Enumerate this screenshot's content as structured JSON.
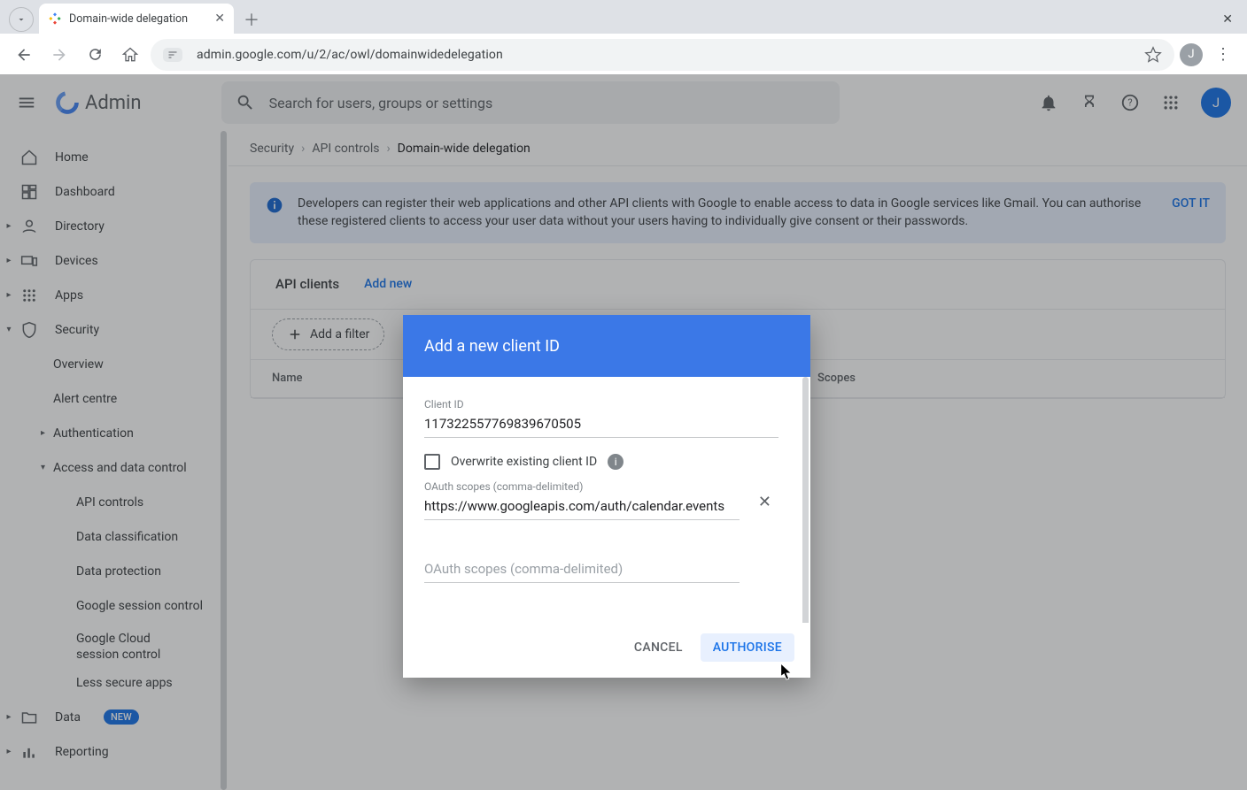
{
  "browser": {
    "tab_title": "Domain-wide delegation",
    "url": "admin.google.com/u/2/ac/owl/domainwidedelegation",
    "avatar_initial": "J"
  },
  "admin": {
    "brand": "Admin",
    "search_placeholder": "Search for users, groups or settings",
    "avatar_initial": "J"
  },
  "sidebar": {
    "home": "Home",
    "dashboard": "Dashboard",
    "directory": "Directory",
    "devices": "Devices",
    "apps": "Apps",
    "security": "Security",
    "overview": "Overview",
    "alert": "Alert centre",
    "authn": "Authentication",
    "access_ctl": "Access and data control",
    "api_controls": "API controls",
    "data_class": "Data classification",
    "data_prot": "Data protection",
    "gsession": "Google session control",
    "gcloudsession": "Google Cloud session control",
    "less_secure": "Less secure apps",
    "data": "Data",
    "data_badge": "NEW",
    "reporting": "Reporting"
  },
  "breadcrumbs": {
    "a": "Security",
    "b": "API controls",
    "c": "Domain-wide delegation"
  },
  "banner": {
    "text": "Developers can register their web applications and other API clients with Google to enable access to data in Google services like Gmail. You can authorise these registered clients to access your user data without your users having to individually give consent or their passwords.",
    "gotit": "GOT IT"
  },
  "panel": {
    "title": "API clients",
    "add_new": "Add new",
    "add_filter": "Add a filter",
    "th_name": "Name",
    "th_scopes": "Scopes"
  },
  "modal": {
    "title": "Add a new client ID",
    "client_id_label": "Client ID",
    "client_id_value": "117322557769839670505",
    "overwrite": "Overwrite existing client ID",
    "scopes_label": "OAuth scopes (comma-delimited)",
    "scopes_value": "https://www.googleapis.com/auth/calendar.events",
    "scopes_placeholder": "OAuth scopes (comma-delimited)",
    "cancel": "CANCEL",
    "authorise": "AUTHORISE"
  }
}
